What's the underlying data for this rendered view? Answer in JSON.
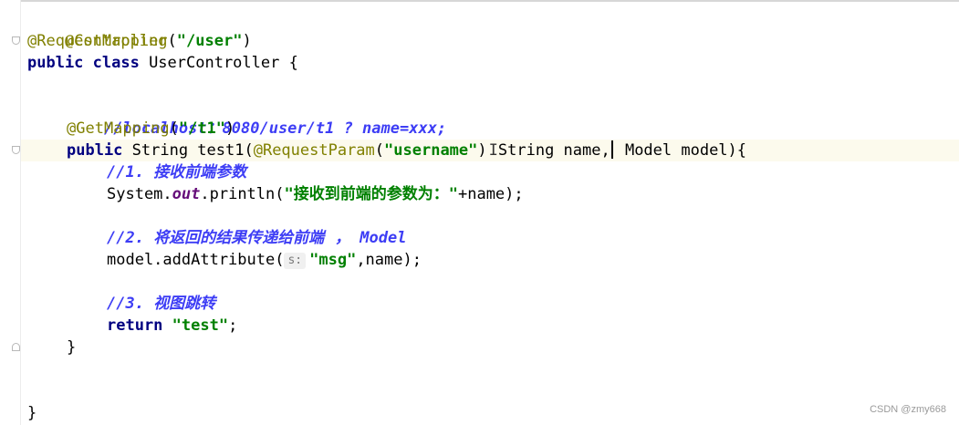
{
  "code": {
    "l1": {
      "annotation": "@Controller"
    },
    "l2": {
      "annotation": "@RequestMapping",
      "open": "(",
      "str": "\"/user\"",
      "close": ")"
    },
    "l3": {
      "kw": "public class",
      "rest": " UserController {"
    },
    "l5": {
      "comment": "//localhost：8080/user/t1 ? name=xxx;"
    },
    "l6": {
      "annotation": "@GetMapping",
      "open": "(",
      "str": "\"/t1\"",
      "close": ")"
    },
    "l7": {
      "kw": "public",
      "sig": " String test1(",
      "annotation": "@RequestParam",
      "open": "(",
      "str": "\"username\"",
      "close": ")",
      "ibeam": "I",
      "p1": "String name,",
      "p2": " Model model){"
    },
    "l8": {
      "comment_prefix": "//1. ",
      "comment_text": "接收前端参数"
    },
    "l9": {
      "pre": "System.",
      "field": "out",
      "mid": ".println(",
      "str": "\"接收到前端的参数为：\"",
      "post": "+name);"
    },
    "l11": {
      "comment_prefix": "//2. ",
      "comment_text": "将返回的结果传递给前端  ，",
      "comment_suffix": " Model"
    },
    "l12": {
      "pre": "model.addAttribute(",
      "hint": "s:",
      "str": "\"msg\"",
      "post": ",name);"
    },
    "l14": {
      "comment_prefix": "//3. ",
      "comment_text": "视图跳转"
    },
    "l15": {
      "kw": "return",
      "sp": " ",
      "str": "\"test\"",
      "post": ";"
    },
    "l16": {
      "text": "}"
    },
    "l19": {
      "text": "}"
    }
  },
  "watermark": "CSDN @zmy668",
  "colors": {
    "annotation": "#808000",
    "keyword": "#000080",
    "string": "#008000",
    "comment": "#3d3df5",
    "field": "#660e7a",
    "current_line": "#fcfaed"
  }
}
